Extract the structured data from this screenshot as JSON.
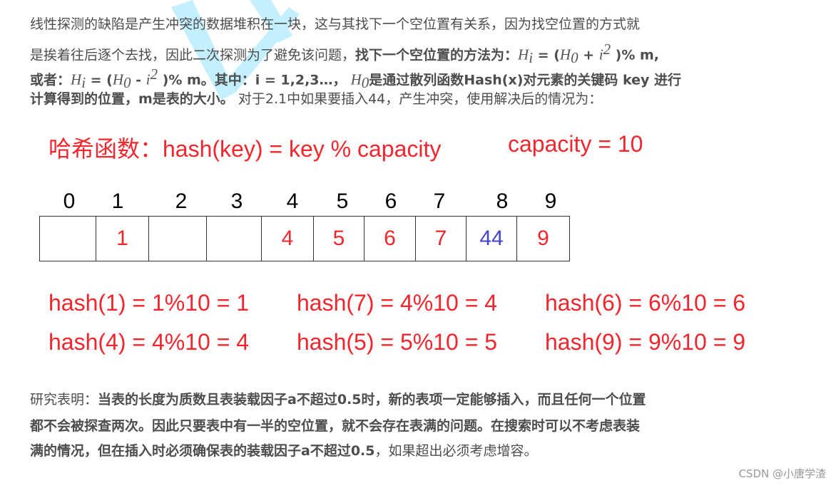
{
  "paragraph1": {
    "l1": "线性探测的缺陷是产生冲突的数据堆积在一块，这与其找下一个空位置有关系，因为找空位置的方式就",
    "l2a": "是挨着往后逐个去找，因此二次探测为了避免该问题，",
    "l2b": "找下一个空位置的方法为：",
    "l2m": "H",
    "l2sub": "i",
    "l2c": " = (",
    "l2m2": "H",
    "l2sub2": "0",
    "l2d": " + ",
    "l2m3": "i",
    "l2sup": "2",
    "l2e": " )% m,",
    "l3a": "或者：",
    "l3c": " = (",
    "l3d": " - ",
    "l3e": " )% m。其中：i = 1,2,3…，",
    "l3f": "是通过散列函数Hash(x)对元素的关键码 key 进行",
    "l4a": "计算得到的位置，m是表的大小。",
    "l4b": " 对于2.1中如果要插入44，产生冲突，使用解决后的情况为："
  },
  "hash_function": {
    "label": "哈希函数：hash(key) = key % capacity",
    "capacity": "capacity = 10"
  },
  "table": {
    "indices": [
      "0",
      "1",
      "2",
      "3",
      "4",
      "5",
      "6",
      "7",
      "8",
      "9"
    ],
    "cells": [
      "",
      "1",
      "",
      "",
      "4",
      "5",
      "6",
      "7",
      "44",
      "9"
    ],
    "highlight_index": 8,
    "colors": {
      "normal": "#f2262c",
      "highlight": "#4444cc"
    }
  },
  "formulas": [
    "hash(1) = 1%10 = 1",
    "hash(7) = 4%10 = 4",
    "hash(6) = 6%10 = 6",
    "hash(4) = 4%10 = 4",
    "hash(5) = 5%10 = 5",
    "hash(9) = 9%10 = 9"
  ],
  "paragraph2": {
    "l1a": "研究表明：",
    "l1b": "当表的长度为质数且表装载因子a不超过0.5时，新的表项一定能够插入，而且任何一个位置",
    "l2": "都不会被探查两次。因此只要表中有一半的空位置，就不会存在表满的问题。在搜索时可以不考虑表装",
    "l3a": "满的情况，但在插入时必须确保表的装载因子a不超过0.5",
    "l3b": "，如果超出必须考虑增容。"
  },
  "watermark": "CSDN @小唐学渣"
}
